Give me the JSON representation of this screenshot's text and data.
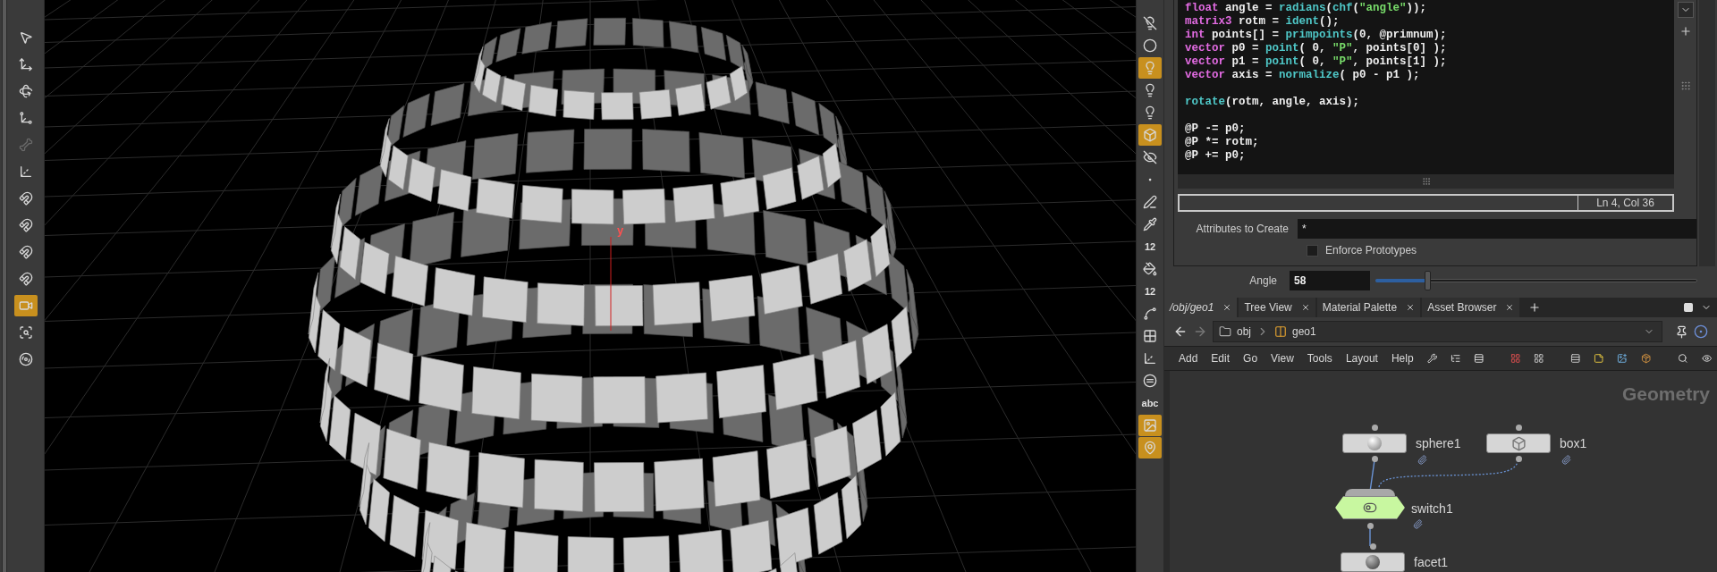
{
  "left_toolbar": {
    "tools": [
      {
        "kind": "select",
        "selected": false,
        "disabled": false
      },
      {
        "kind": "move",
        "selected": false,
        "disabled": false
      },
      {
        "kind": "rotate",
        "selected": false,
        "disabled": false
      },
      {
        "kind": "scale",
        "selected": false,
        "disabled": false
      },
      {
        "kind": "pose",
        "selected": false,
        "disabled": true
      },
      {
        "kind": "handle",
        "selected": false,
        "disabled": false
      },
      {
        "kind": "snap",
        "selected": false,
        "disabled": false
      },
      {
        "kind": "snap",
        "selected": false,
        "disabled": false
      },
      {
        "kind": "snap",
        "selected": false,
        "disabled": false
      },
      {
        "kind": "snap",
        "selected": false,
        "disabled": false
      },
      {
        "kind": "camera",
        "selected": true,
        "disabled": false
      },
      {
        "kind": "region",
        "selected": false,
        "disabled": false
      },
      {
        "kind": "render",
        "selected": false,
        "disabled": false
      }
    ]
  },
  "viewport": {
    "axis_label": "y"
  },
  "right_toolbar": {
    "tools": [
      {
        "kind": "lights-off",
        "selected": false
      },
      {
        "kind": "ball",
        "selected": false
      },
      {
        "kind": "light",
        "selected": true
      },
      {
        "kind": "light",
        "selected": false
      },
      {
        "kind": "light",
        "selected": false
      },
      {
        "kind": "cube",
        "selected": true
      },
      {
        "kind": "eye",
        "selected": false
      },
      {
        "kind": "dot",
        "selected": false
      },
      {
        "kind": "pen",
        "selected": false
      },
      {
        "kind": "pipette",
        "selected": false
      },
      {
        "kind": "label",
        "label": "12",
        "selected": false
      },
      {
        "kind": "bucket",
        "selected": false
      },
      {
        "kind": "label",
        "label": "12",
        "selected": false
      },
      {
        "kind": "curve",
        "selected": false
      },
      {
        "kind": "grid",
        "selected": false
      },
      {
        "kind": "axes",
        "selected": false
      },
      {
        "kind": "circle",
        "selected": false
      },
      {
        "kind": "label",
        "label": "abc",
        "selected": false
      },
      {
        "kind": "image",
        "selected": true
      },
      {
        "kind": "pin",
        "selected": true
      }
    ]
  },
  "code_editor": {
    "lines": [
      {
        "tokens": [
          {
            "kind": "type",
            "text": "float"
          },
          {
            "kind": "plain",
            "text": " angle = "
          },
          {
            "kind": "func",
            "text": "radians"
          },
          {
            "kind": "plain",
            "text": "("
          },
          {
            "kind": "func",
            "text": "chf"
          },
          {
            "kind": "plain",
            "text": "("
          },
          {
            "kind": "string",
            "text": "\"angle\""
          },
          {
            "kind": "plain",
            "text": "));"
          }
        ]
      },
      {
        "tokens": [
          {
            "kind": "type",
            "text": "matrix3"
          },
          {
            "kind": "plain",
            "text": " rotm = "
          },
          {
            "kind": "func",
            "text": "ident"
          },
          {
            "kind": "plain",
            "text": "();"
          }
        ]
      },
      {
        "tokens": [
          {
            "kind": "type",
            "text": "int"
          },
          {
            "kind": "plain",
            "text": " points[] = "
          },
          {
            "kind": "func",
            "text": "primpoints"
          },
          {
            "kind": "plain",
            "text": "(0, @primnum);"
          }
        ]
      },
      {
        "tokens": [
          {
            "kind": "type",
            "text": "vector"
          },
          {
            "kind": "plain",
            "text": " p0 = "
          },
          {
            "kind": "func",
            "text": "point"
          },
          {
            "kind": "plain",
            "text": "( 0, "
          },
          {
            "kind": "string",
            "text": "\"P\""
          },
          {
            "kind": "plain",
            "text": ", points[0] );"
          }
        ]
      },
      {
        "tokens": [
          {
            "kind": "type",
            "text": "vector"
          },
          {
            "kind": "plain",
            "text": " p1 = "
          },
          {
            "kind": "func",
            "text": "point"
          },
          {
            "kind": "plain",
            "text": "( 0, "
          },
          {
            "kind": "string",
            "text": "\"P\""
          },
          {
            "kind": "plain",
            "text": ", points[1] );"
          }
        ]
      },
      {
        "tokens": [
          {
            "kind": "type",
            "text": "vector"
          },
          {
            "kind": "plain",
            "text": " axis = "
          },
          {
            "kind": "func",
            "text": "normalize"
          },
          {
            "kind": "plain",
            "text": "( p0 - p1 );"
          }
        ]
      },
      {
        "blank_before": true,
        "tokens": [
          {
            "kind": "func",
            "text": "rotate"
          },
          {
            "kind": "plain",
            "text": "(rotm, angle, axis);"
          }
        ]
      },
      {
        "blank_before": true,
        "tokens": [
          {
            "kind": "plain",
            "text": "@P -= p0;"
          }
        ]
      },
      {
        "tokens": [
          {
            "kind": "plain",
            "text": "@P *= rotm;"
          }
        ]
      },
      {
        "tokens": [
          {
            "kind": "plain",
            "text": "@P += p0;"
          }
        ]
      }
    ],
    "position": "Ln 4, Col 36"
  },
  "parameters": [
    {
      "kind": "text",
      "label": "Attributes to Create",
      "value": "*"
    },
    {
      "kind": "checkbox",
      "label": "Enforce Prototypes",
      "checked": false
    },
    {
      "kind": "slider",
      "label": "Angle",
      "value": "58",
      "level": 0.16
    }
  ],
  "tabs": [
    {
      "label": "/obj/geo1",
      "selected": true
    },
    {
      "label": "Tree View",
      "selected": false
    },
    {
      "label": "Material Palette",
      "selected": false
    },
    {
      "label": "Asset Browser",
      "selected": false
    }
  ],
  "path_bar": {
    "segments": [
      {
        "kind": "root",
        "label": "obj"
      },
      {
        "kind": "geometry",
        "label": "geo1"
      }
    ]
  },
  "menu": [
    "Add",
    "Edit",
    "Go",
    "View",
    "Tools",
    "Layout",
    "Help"
  ],
  "network": {
    "context_label": "Geometry",
    "nodes": [
      {
        "name": "sphere1",
        "kind": "sphere",
        "current": false
      },
      {
        "name": "box1",
        "kind": "box",
        "current": false
      },
      {
        "name": "switch1",
        "kind": "switch",
        "current": true
      },
      {
        "name": "facet1",
        "kind": "facet",
        "current": false
      }
    ]
  }
}
